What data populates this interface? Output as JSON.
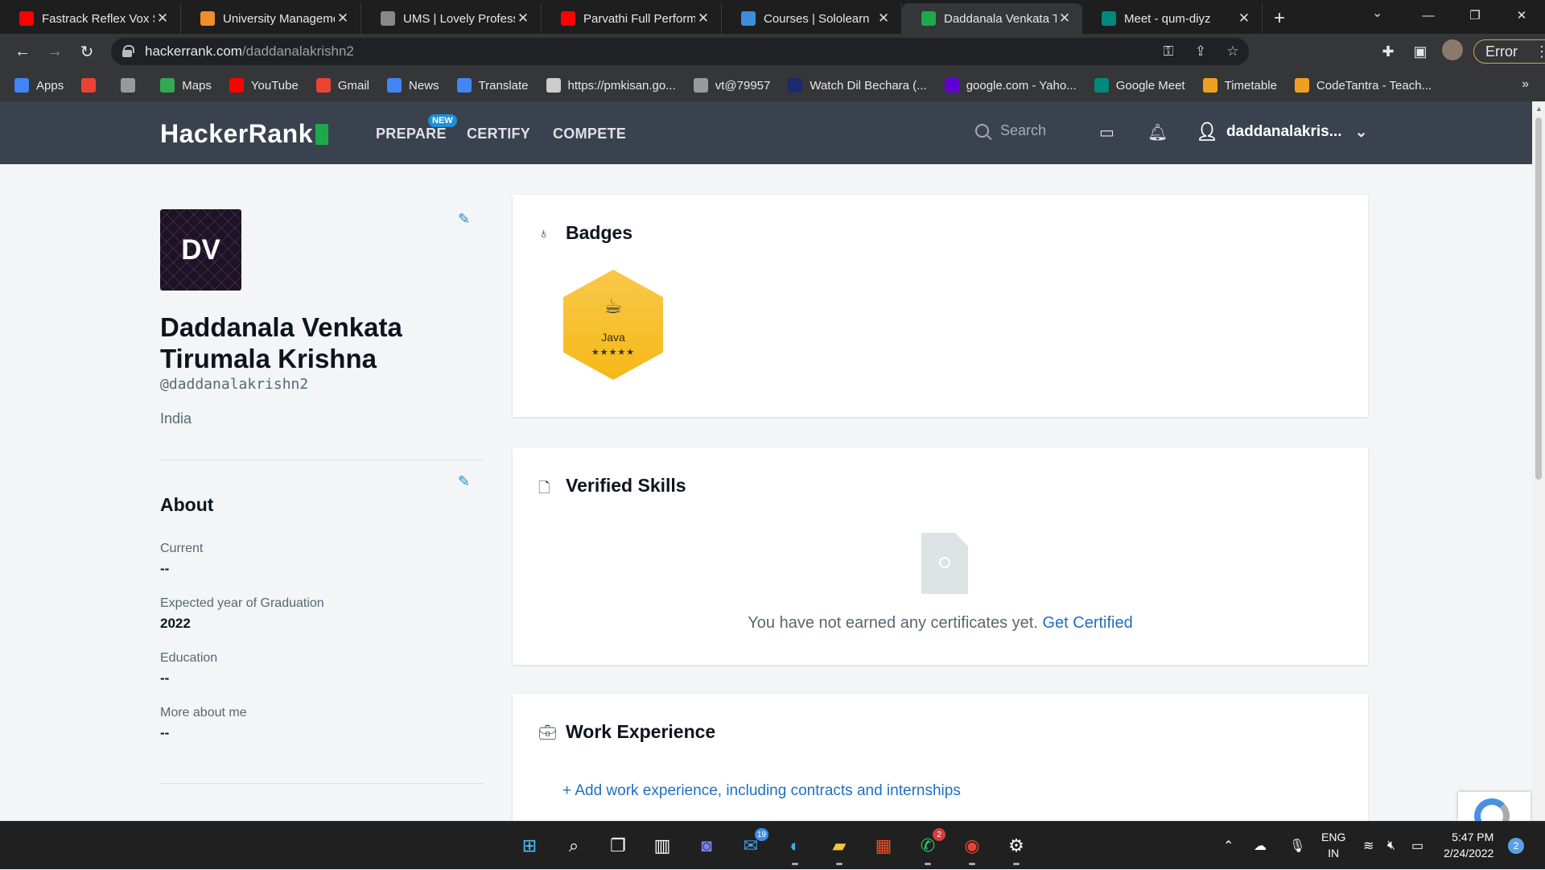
{
  "browser": {
    "tabs": [
      {
        "title": "Fastrack Reflex Vox Sm",
        "favicon": "youtube-icon",
        "color": "#ff0000"
      },
      {
        "title": "University Manageme",
        "favicon": "ums-icon",
        "color": "#f08c2a"
      },
      {
        "title": "UMS | Lovely Professio",
        "favicon": "globe-icon",
        "color": "#888888"
      },
      {
        "title": "Parvathi Full Performa",
        "favicon": "youtube-icon",
        "color": "#ff0000"
      },
      {
        "title": "Courses | Sololearn",
        "favicon": "sololearn-icon",
        "color": "#3c8dde"
      },
      {
        "title": "Daddanala Venkata T",
        "favicon": "hackerrank-icon",
        "color": "#1ba94c"
      },
      {
        "title": "Meet - qum-diyz",
        "favicon": "meet-icon",
        "color": "#00897b"
      }
    ],
    "active_tab": 5,
    "url_host": "hackerrank.com",
    "url_path": "/daddanalakrishn2",
    "error_label": "Error",
    "bookmarks": [
      {
        "label": "Apps",
        "icon": "apps-grid-icon",
        "color": "#4285f4"
      },
      {
        "label": "",
        "icon": "gmail-icon",
        "color": "#ea4335"
      },
      {
        "label": "",
        "icon": "globe-icon",
        "color": "#999999"
      },
      {
        "label": "Maps",
        "icon": "maps-icon",
        "color": "#34a853"
      },
      {
        "label": "YouTube",
        "icon": "youtube-icon",
        "color": "#ff0000"
      },
      {
        "label": "Gmail",
        "icon": "gmail-icon",
        "color": "#ea4335"
      },
      {
        "label": "News",
        "icon": "news-icon",
        "color": "#4285f4"
      },
      {
        "label": "Translate",
        "icon": "translate-icon",
        "color": "#4285f4"
      },
      {
        "label": "https://pmkisan.go...",
        "icon": "page-icon",
        "color": "#cccccc"
      },
      {
        "label": "vt@79957",
        "icon": "globe-icon",
        "color": "#999999"
      },
      {
        "label": "Watch Dil Bechara (...",
        "icon": "movie-icon",
        "color": "#1a2a6a"
      },
      {
        "label": "google.com - Yaho...",
        "icon": "yahoo-icon",
        "color": "#6001d2"
      },
      {
        "label": "Google Meet",
        "icon": "meet-icon",
        "color": "#00897b"
      },
      {
        "label": "Timetable",
        "icon": "sun-icon",
        "color": "#f0a020"
      },
      {
        "label": "CodeTantra - Teach...",
        "icon": "sun-icon",
        "color": "#f0a020"
      }
    ]
  },
  "nav": {
    "logo_text": "HackerRank",
    "prepare": "PREPARE",
    "new_badge": "NEW",
    "certify": "CERTIFY",
    "compete": "COMPETE",
    "search_placeholder": "Search",
    "username": "daddanalakris..."
  },
  "profile": {
    "initials": "DV",
    "name": "Daddanala Venkata Tirumala Krishna",
    "handle": "@daddanalakrishn2",
    "country": "India",
    "about_heading": "About",
    "fields": [
      {
        "label": "Current",
        "value": "--"
      },
      {
        "label": "Expected year of Graduation",
        "value": "2022"
      },
      {
        "label": "Education",
        "value": "--"
      },
      {
        "label": "More about me",
        "value": "--"
      }
    ]
  },
  "badges": {
    "heading": "Badges",
    "items": [
      {
        "name": "Java",
        "stars": "★★★★★"
      }
    ]
  },
  "verified_skills": {
    "heading": "Verified Skills",
    "empty_text": "You have not earned any certificates yet.",
    "cta": "Get Certified"
  },
  "work_experience": {
    "heading": "Work Experience",
    "add_link": "+ Add work experience, including contracts and internships"
  },
  "taskbar": {
    "apps": [
      {
        "name": "start-icon",
        "badge": ""
      },
      {
        "name": "search-icon",
        "badge": ""
      },
      {
        "name": "task-view-icon",
        "badge": ""
      },
      {
        "name": "widgets-icon",
        "badge": ""
      },
      {
        "name": "teams-chat-icon",
        "badge": ""
      },
      {
        "name": "mail-icon",
        "badge": "19"
      },
      {
        "name": "edge-icon",
        "badge": ""
      },
      {
        "name": "file-explorer-icon",
        "badge": ""
      },
      {
        "name": "store-icon",
        "badge": ""
      },
      {
        "name": "whatsapp-icon",
        "badge": "2"
      },
      {
        "name": "chrome-icon",
        "badge": ""
      },
      {
        "name": "settings-icon",
        "badge": ""
      }
    ],
    "lang_top": "ENG",
    "lang_bottom": "IN",
    "time": "5:47 PM",
    "date": "2/24/2022",
    "notifications": "2"
  }
}
